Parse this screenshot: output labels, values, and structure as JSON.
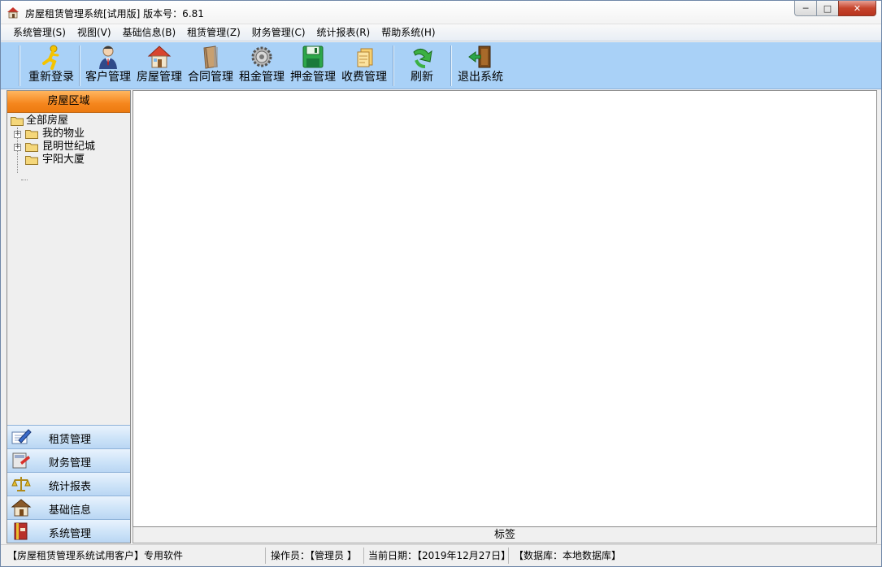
{
  "window": {
    "title": "房屋租赁管理系统[试用版]  版本号：6.81",
    "minimize": "─",
    "maximize": "□",
    "close": "✕"
  },
  "menubar": {
    "items": [
      "系统管理(S)",
      "视图(V)",
      "基础信息(B)",
      "租赁管理(Z)",
      "财务管理(C)",
      "统计报表(R)",
      "帮助系统(H)"
    ]
  },
  "toolbar": {
    "buttons": [
      {
        "label": "重新登录",
        "icon": "runner-login-icon"
      },
      {
        "label": "客户管理",
        "icon": "customer-person-icon"
      },
      {
        "label": "房屋管理",
        "icon": "house-icon"
      },
      {
        "label": "合同管理",
        "icon": "contract-book-icon"
      },
      {
        "label": "租金管理",
        "icon": "gear-coin-icon"
      },
      {
        "label": "押金管理",
        "icon": "floppy-disk-icon"
      },
      {
        "label": "收费管理",
        "icon": "document-stack-icon"
      },
      {
        "label": "刷新",
        "icon": "refresh-arrow-icon"
      },
      {
        "label": "退出系统",
        "icon": "exit-door-icon"
      }
    ]
  },
  "leftpanel": {
    "header": "房屋区域",
    "tree": {
      "root": "全部房屋",
      "children": [
        "我的物业",
        "昆明世纪城",
        "宇阳大厦"
      ]
    },
    "outlook": [
      {
        "label": "租赁管理",
        "icon": "pen-paper-icon"
      },
      {
        "label": "财务管理",
        "icon": "calculator-icon"
      },
      {
        "label": "统计报表",
        "icon": "scales-icon"
      },
      {
        "label": "基础信息",
        "icon": "home-icon"
      },
      {
        "label": "系统管理",
        "icon": "book-icon"
      }
    ]
  },
  "main": {
    "tab_label": "标签"
  },
  "statusbar": {
    "license": "【房屋租赁管理系统试用客户】专用软件",
    "operator": "操作员：【管理员  】",
    "date": "当前日期：【2019年12月27日】",
    "database": "【数据库：本地数据库】"
  },
  "colors": {
    "toolbar_bg": "#a9d1f7",
    "panel_header": "#f5861d",
    "outlook_bar": "#cde3f8"
  }
}
